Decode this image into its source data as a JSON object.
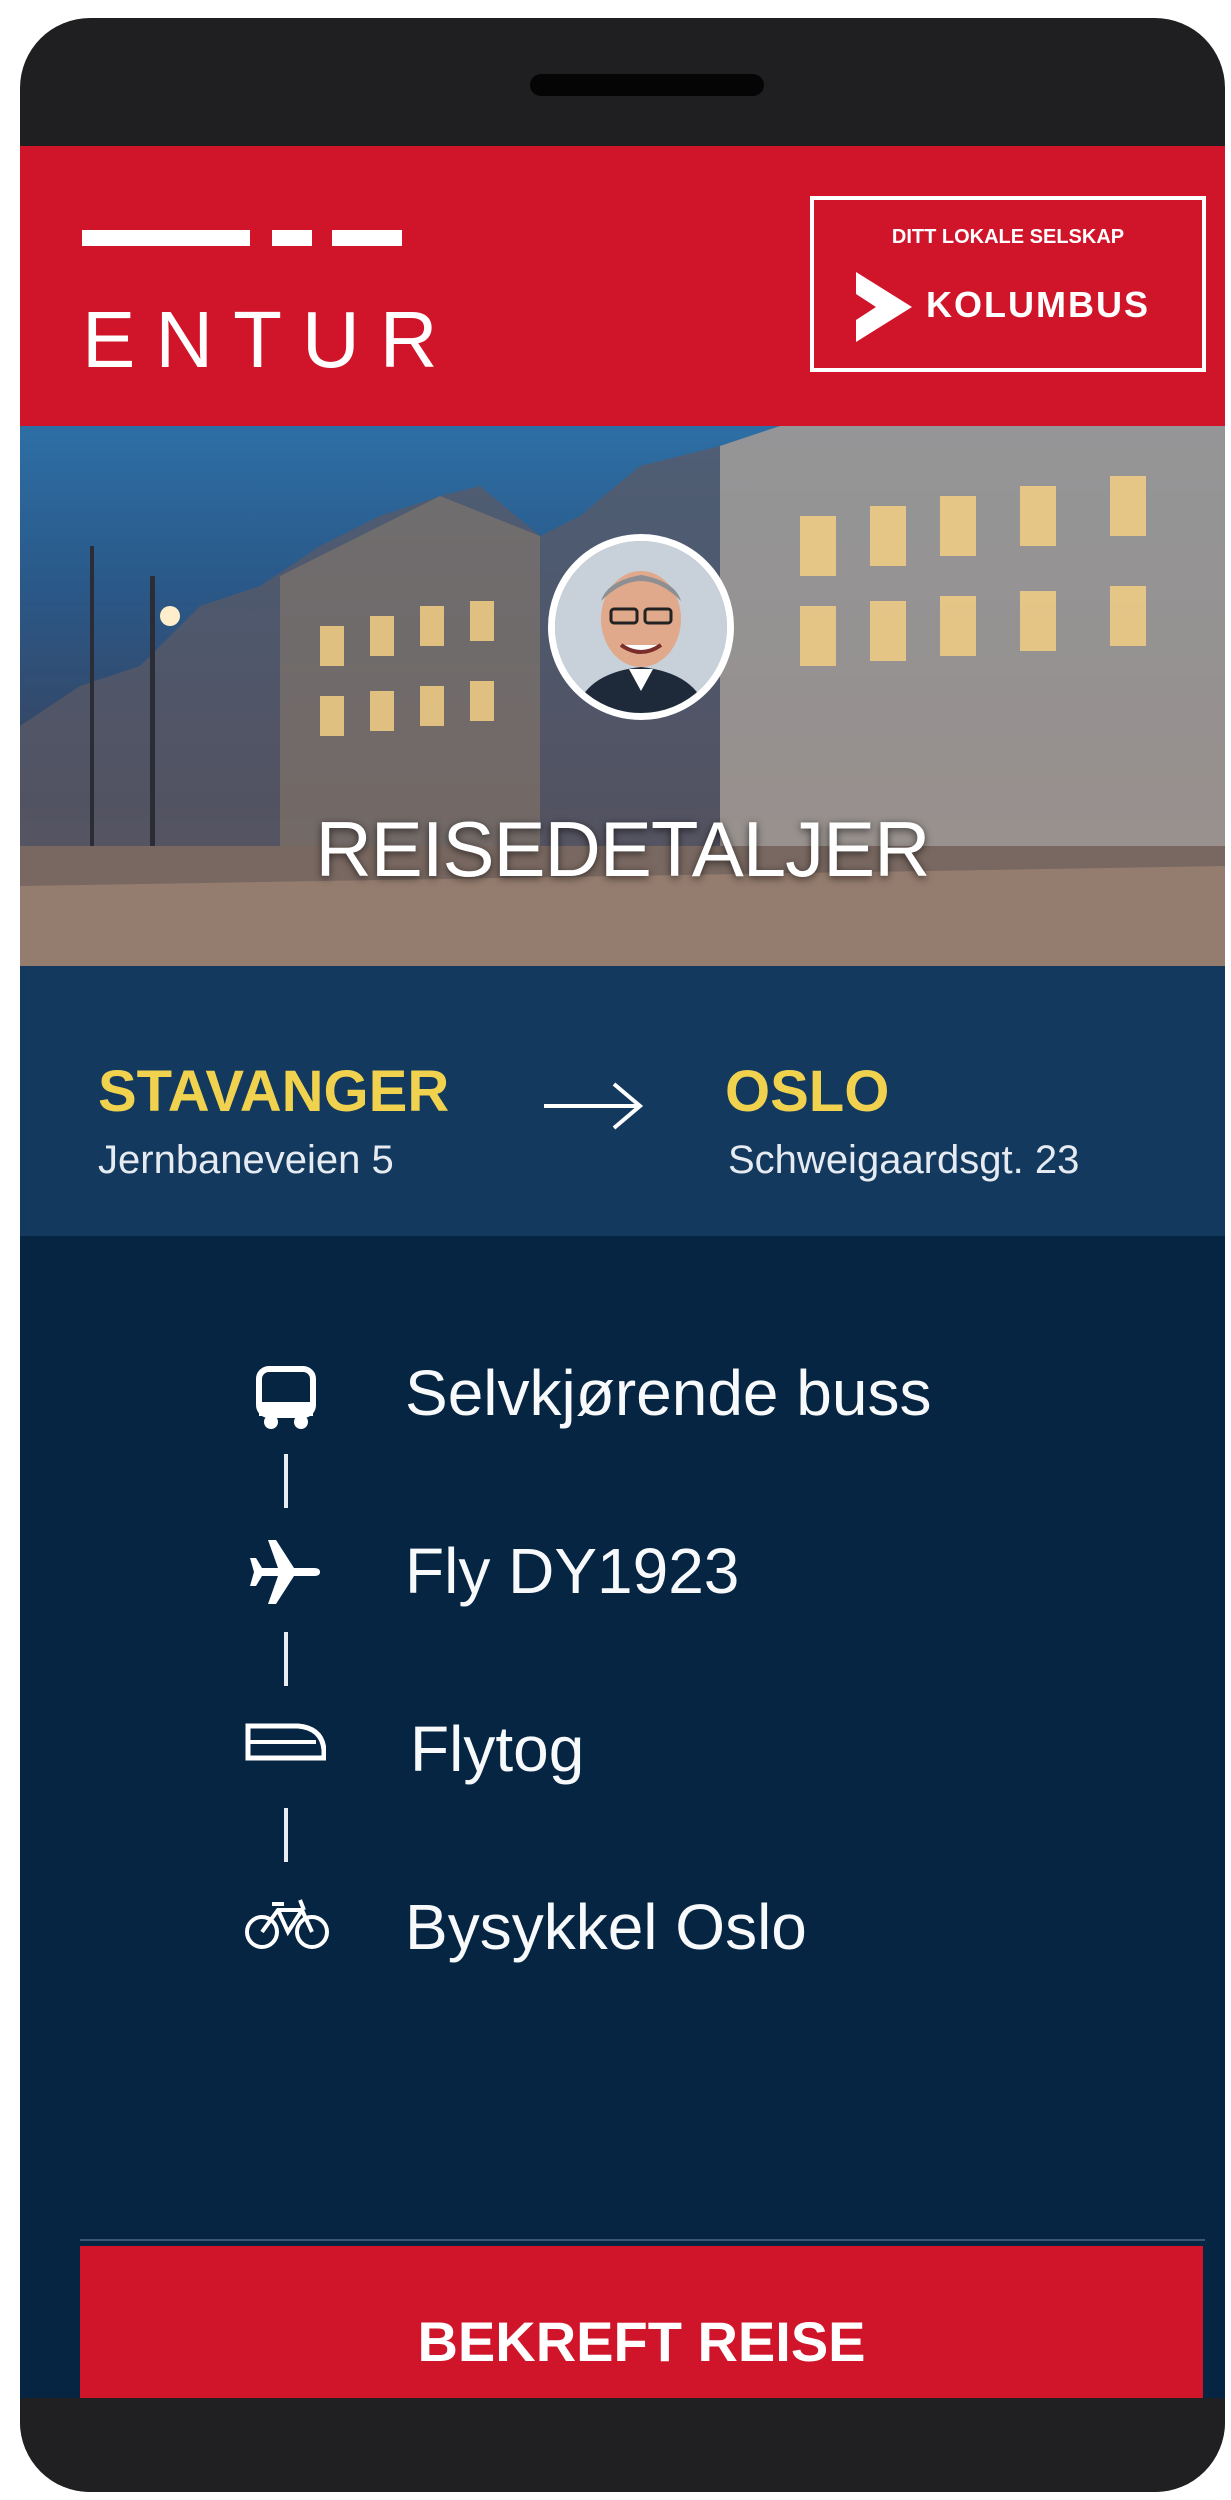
{
  "header": {
    "logo_text": "ENTUR",
    "partner_tag": "DITT LOKALE SELSKAP",
    "partner_name": "KOLUMBUS"
  },
  "hero": {
    "title": "REISEDETALJER"
  },
  "route": {
    "from_city": "STAVANGER",
    "from_address": "Jernbaneveien 5",
    "to_city": "OSLO",
    "to_address": "Schweigaardsgt. 23"
  },
  "legs": [
    {
      "icon": "bus-icon",
      "label": "Selvkjørende buss"
    },
    {
      "icon": "airplane-icon",
      "label": "Fly DY1923"
    },
    {
      "icon": "train-icon",
      "label": "Flytog"
    },
    {
      "icon": "bicycle-icon",
      "label": "Bysykkel Oslo"
    }
  ],
  "cta": {
    "label": "BEKREFT REISE"
  },
  "colors": {
    "brand_red": "#d0152a",
    "navy": "#052542",
    "accent_yellow": "#f0d24f"
  }
}
